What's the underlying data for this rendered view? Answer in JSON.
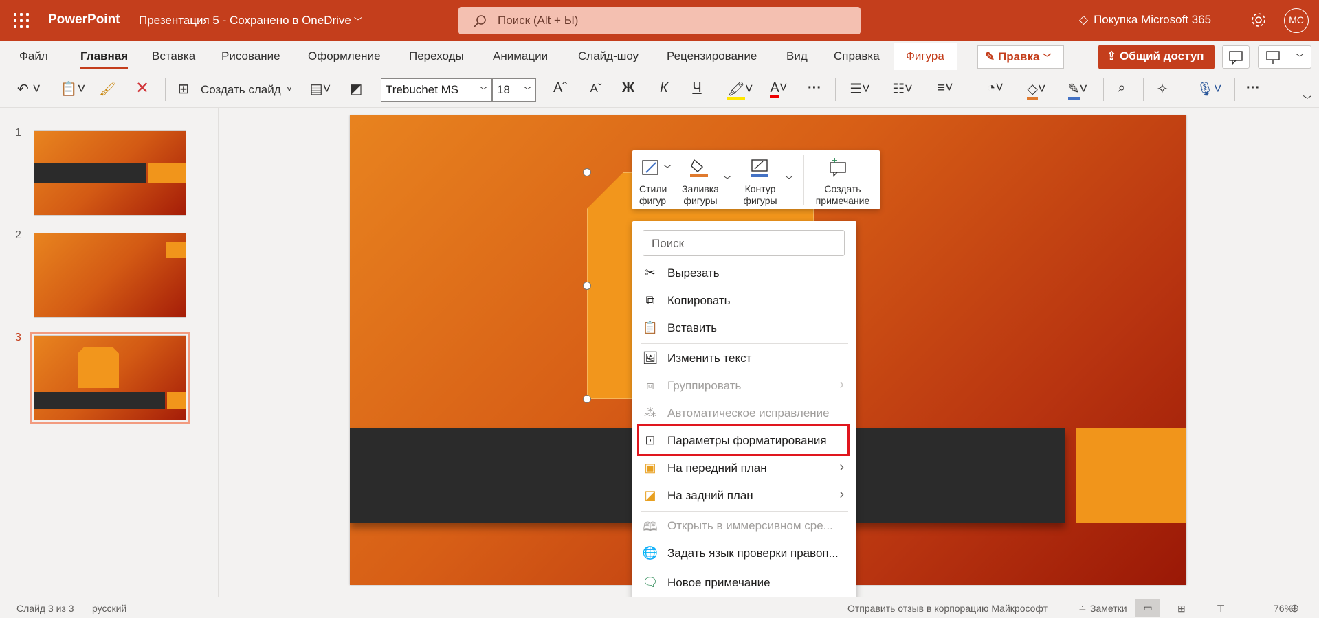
{
  "titlebar": {
    "app_name": "PowerPoint",
    "doc_title": "Презентация 5 - Сохранено в OneDrive",
    "search_placeholder": "Поиск (Alt + Ы)",
    "buy": "Покупка Microsoft 365",
    "avatar": "МС",
    "bg_color": "#c43e1c"
  },
  "ribbon": {
    "tabs": [
      "Файл",
      "Главная",
      "Вставка",
      "Рисование",
      "Оформление",
      "Переходы",
      "Анимации",
      "Слайд-шоу",
      "Рецензирование",
      "Вид",
      "Справка",
      "Фигура"
    ],
    "active_tab": "Главная",
    "edit_mode": "Правка",
    "share": "Общий доступ",
    "new_slide": "Создать слайд",
    "font": "Trebuchet MS",
    "font_size": "18",
    "bold": "Ж",
    "italic": "К",
    "underline": "Ч"
  },
  "thumbnails": {
    "numbers": [
      "1",
      "2",
      "3"
    ],
    "selected": "3"
  },
  "mini_toolbar": {
    "styles": "Стили фигур",
    "fill": "Заливка фигуры",
    "outline": "Контур фигуры",
    "comment": "Создать примечание"
  },
  "context_menu": {
    "search_placeholder": "Поиск",
    "items": [
      {
        "label": "Вырезать",
        "icon": "scissors-icon",
        "enabled": true
      },
      {
        "label": "Копировать",
        "icon": "copy-icon",
        "enabled": true
      },
      {
        "label": "Вставить",
        "icon": "paste-icon",
        "enabled": true
      },
      {
        "label": "Изменить текст",
        "icon": "edit-text-icon",
        "enabled": true
      },
      {
        "label": "Группировать",
        "icon": "group-icon",
        "enabled": false
      },
      {
        "label": "Автоматическое исправление",
        "icon": "autocorrect-icon",
        "enabled": false
      },
      {
        "label": "Параметры форматирования",
        "icon": "format-options-icon",
        "enabled": true,
        "highlighted": true
      },
      {
        "label": "На передний план",
        "icon": "bring-forward-icon",
        "enabled": true
      },
      {
        "label": "На задний план",
        "icon": "send-backward-icon",
        "enabled": true
      },
      {
        "label": "Открыть в иммерсивном сре...",
        "icon": "immersive-reader-icon",
        "enabled": false
      },
      {
        "label": "Задать язык проверки правоп...",
        "icon": "proofing-language-icon",
        "enabled": true
      },
      {
        "label": "Новое примечание",
        "icon": "new-comment-icon",
        "enabled": true
      }
    ]
  },
  "statusbar": {
    "slide_info": "Слайд 3 из 3",
    "language": "русский",
    "feedback": "Отправить отзыв в корпорацию Майкрософт",
    "notes": "Заметки",
    "zoom": "76%"
  }
}
